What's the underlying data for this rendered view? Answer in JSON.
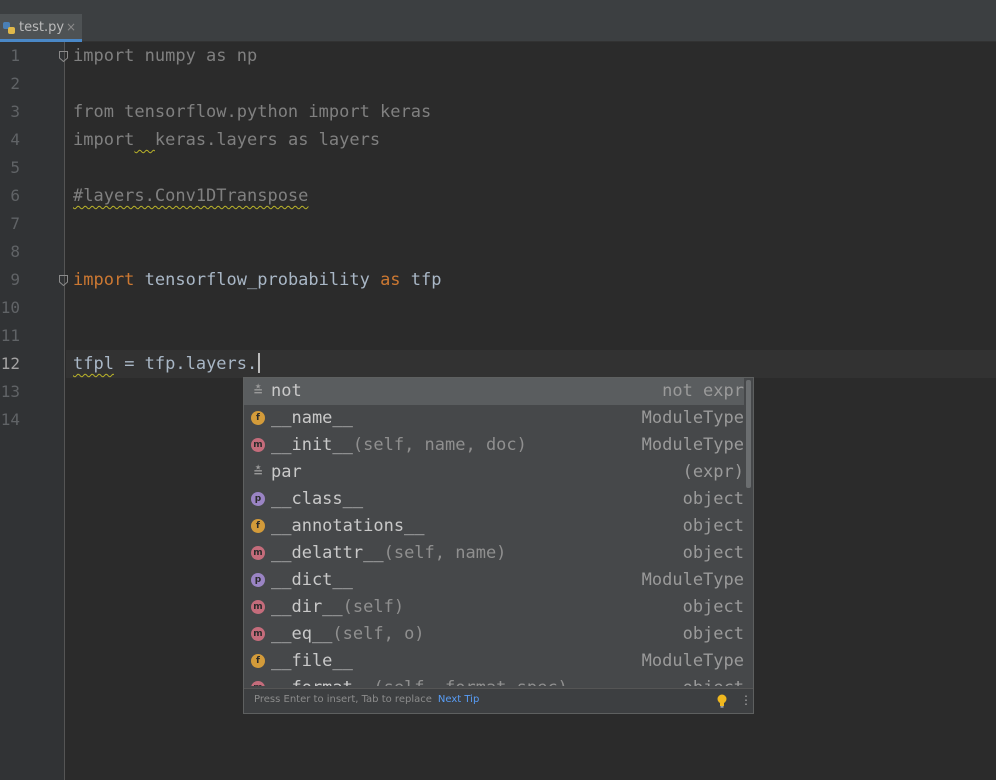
{
  "tab": {
    "filename": "test.py",
    "close": "×",
    "icon": "python-file-icon"
  },
  "gutter": {
    "line_numbers": [
      "1",
      "2",
      "3",
      "4",
      "5",
      "6",
      "7",
      "8",
      "9",
      "10",
      "11",
      "12",
      "13",
      "14"
    ],
    "current_line": "12"
  },
  "code": {
    "l1": "import numpy as np",
    "l3": "from tensorflow.python import keras",
    "l4_a": "import",
    "l4_b": "  ",
    "l4_c": "keras.layers as layers",
    "l6": "#layers.Conv1DTranspose",
    "l9_import": "import",
    "l9_mod": " tensorflow_probability ",
    "l9_as": "as",
    "l9_alias": " tfp",
    "l12_var": "tfpl",
    "l12_rest": " = tfp.layers."
  },
  "completion": {
    "items": [
      {
        "icon": "template-icon",
        "glyph": "≛",
        "name": "not",
        "args": "",
        "type": "not expr"
      },
      {
        "icon": "field-icon",
        "glyph": "f",
        "name": "__name__",
        "args": "",
        "type": "ModuleType"
      },
      {
        "icon": "method-icon",
        "glyph": "m",
        "name": "__init__",
        "args": "(self, name, doc)",
        "type": "ModuleType"
      },
      {
        "icon": "template-icon",
        "glyph": "≛",
        "name": "par",
        "args": "",
        "type": "(expr)"
      },
      {
        "icon": "property-icon",
        "glyph": "p",
        "name": "__class__",
        "args": "",
        "type": "object"
      },
      {
        "icon": "field-icon",
        "glyph": "f",
        "name": "__annotations__",
        "args": "",
        "type": "object"
      },
      {
        "icon": "method-icon",
        "glyph": "m",
        "name": "__delattr__",
        "args": "(self, name)",
        "type": "object"
      },
      {
        "icon": "property-icon",
        "glyph": "p",
        "name": "__dict__",
        "args": "",
        "type": "ModuleType"
      },
      {
        "icon": "method-icon",
        "glyph": "m",
        "name": "__dir__",
        "args": "(self)",
        "type": "object"
      },
      {
        "icon": "method-icon",
        "glyph": "m",
        "name": "__eq__",
        "args": "(self, o)",
        "type": "object"
      },
      {
        "icon": "field-icon",
        "glyph": "f",
        "name": "__file__",
        "args": "",
        "type": "ModuleType"
      },
      {
        "icon": "method-icon",
        "glyph": "m",
        "name": "__format__",
        "args": "(self, format_spec)",
        "type": "object"
      }
    ],
    "footer_hint": "Press Enter to insert, Tab to replace",
    "footer_tip": "Next Tip",
    "more": "⋮"
  }
}
